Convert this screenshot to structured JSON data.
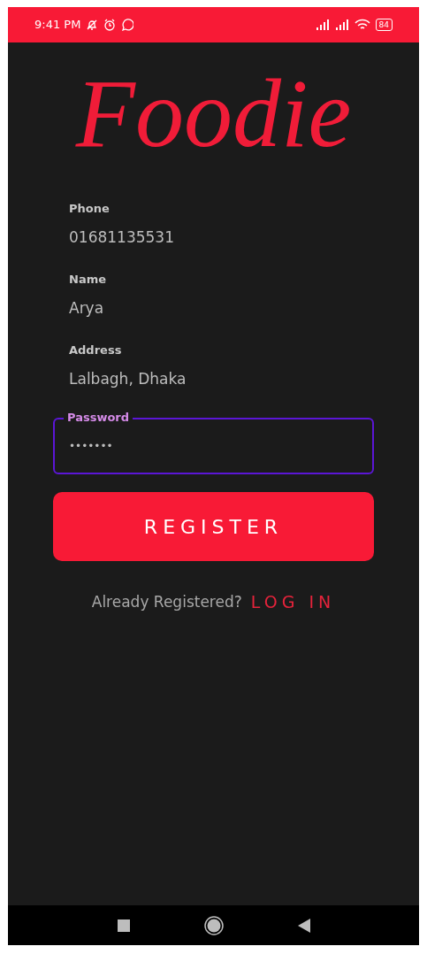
{
  "status_bar": {
    "time": "9:41 PM",
    "battery": "84"
  },
  "logo": "Foodie",
  "fields": [
    {
      "label": "Phone",
      "value": "01681135531",
      "focused": false
    },
    {
      "label": "Name",
      "value": "Arya",
      "focused": false
    },
    {
      "label": "Address",
      "value": "Lalbagh, Dhaka",
      "focused": false
    },
    {
      "label": "Password",
      "value": "•••••••",
      "focused": true
    }
  ],
  "register_button": "REGISTER",
  "login_prompt": {
    "text": "Already Registered?",
    "link": "LOG IN"
  }
}
